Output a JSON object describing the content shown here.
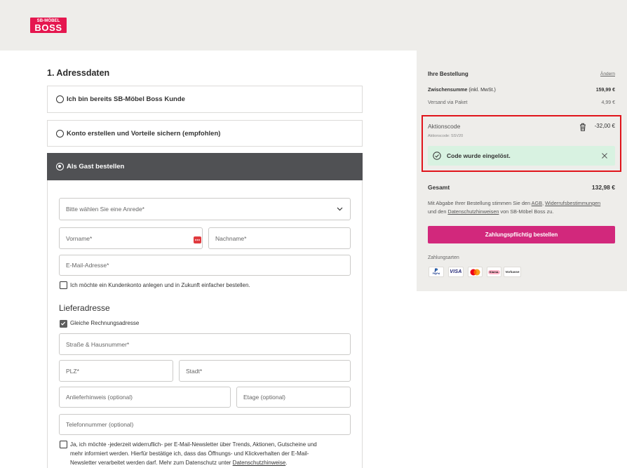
{
  "colors": {
    "panel_bg": "#eeedea",
    "brand": "#e5174f",
    "selected_option_bg": "#505154",
    "order_button": "#d2287c",
    "promo_highlight_border": "#e0141b",
    "success_bg": "#d8f2e1"
  },
  "logo": {
    "line1": "SB-MÖBEL",
    "line2": "BOSS"
  },
  "address": {
    "title": "1. Adressdaten",
    "options": [
      {
        "label": "Ich bin bereits SB-Möbel Boss Kunde",
        "selected": false
      },
      {
        "label": "Konto erstellen und Vorteile sichern (empfohlen)",
        "selected": false
      },
      {
        "label": "Als Gast bestellen",
        "selected": true
      }
    ],
    "form": {
      "salutation": {
        "placeholder": "Bitte wählen Sie eine Anrede*",
        "icon": "chevron-down-icon"
      },
      "first_name": {
        "placeholder": "Vorname*"
      },
      "last_name": {
        "placeholder": "Nachname*"
      },
      "email": {
        "placeholder": "E-Mail-Adresse*"
      },
      "create_account": {
        "label": "Ich möchte ein Kundenkonto anlegen und in Zukunft einfacher bestellen.",
        "checked": false
      },
      "delivery_title": "Lieferadresse",
      "same_billing": {
        "label": "Gleiche Rechnungsadresse",
        "checked": true
      },
      "street": {
        "placeholder": "Straße & Hausnummer*"
      },
      "zip": {
        "placeholder": "PLZ*"
      },
      "city": {
        "placeholder": "Stadt*"
      },
      "delivery_note": {
        "placeholder": "Anlieferhinweis (optional)"
      },
      "floor": {
        "placeholder": "Etage (optional)"
      },
      "phone": {
        "placeholder": "Telefonnummer (optional)"
      },
      "newsletter": {
        "checked": false,
        "line1": "Ja, ich möchte -jederzeit widerruflich- per E-Mail-Newsletter über Trends, Aktionen, Gutscheine und",
        "line2": "mehr informiert werden. Hierfür bestätige ich, dass das Öffnungs- und Klickverhalten der E-Mail-",
        "line3": "Newsletter verarbeitet werden darf. Mehr zum Datenschutz unter",
        "link": "Datenschutzhinweise",
        "end": "."
      }
    }
  },
  "order": {
    "title": "Ihre Bestellung",
    "edit_link": "Ändern",
    "subtotal": {
      "label": "Zwischensumme",
      "note": "(inkl. MwSt.)",
      "amount": "159,99 €"
    },
    "shipping": {
      "label": "Versand via Paket",
      "amount": "4,99 €"
    },
    "promo": {
      "label": "Aktionscode",
      "amount": "-32,00 €",
      "code_line": "Aktionscode: SSV20",
      "delete_icon": "trash-icon",
      "success_message": "Code wurde eingelöst.",
      "success_icon": "check-circle-icon",
      "dismiss_icon": "close-icon"
    },
    "total": {
      "label": "Gesamt",
      "amount": "132,98 €"
    },
    "legal": {
      "pre": "Mit Abgabe Ihrer Bestellung stimmen Sie den",
      "agb": "AGB",
      "comma": ",",
      "withdrawal": "Widerrufsbestimmungen",
      "und": "und den",
      "privacy": "Datenschutzhinweisen",
      "post": "von SB-Möbel Boss zu."
    },
    "submit_label": "Zahlungspflichtig bestellen",
    "payment": {
      "title": "Zahlungsarten",
      "methods": [
        {
          "icon": "paypal-icon",
          "label": "PayPal"
        },
        {
          "icon": "visa-icon",
          "label": "VISA"
        },
        {
          "icon": "mastercard-icon",
          "label": ""
        },
        {
          "icon": "klarna-icon",
          "label": "Klarna."
        },
        {
          "icon": "prepayment-icon",
          "label": "Vorkasse"
        }
      ]
    }
  }
}
